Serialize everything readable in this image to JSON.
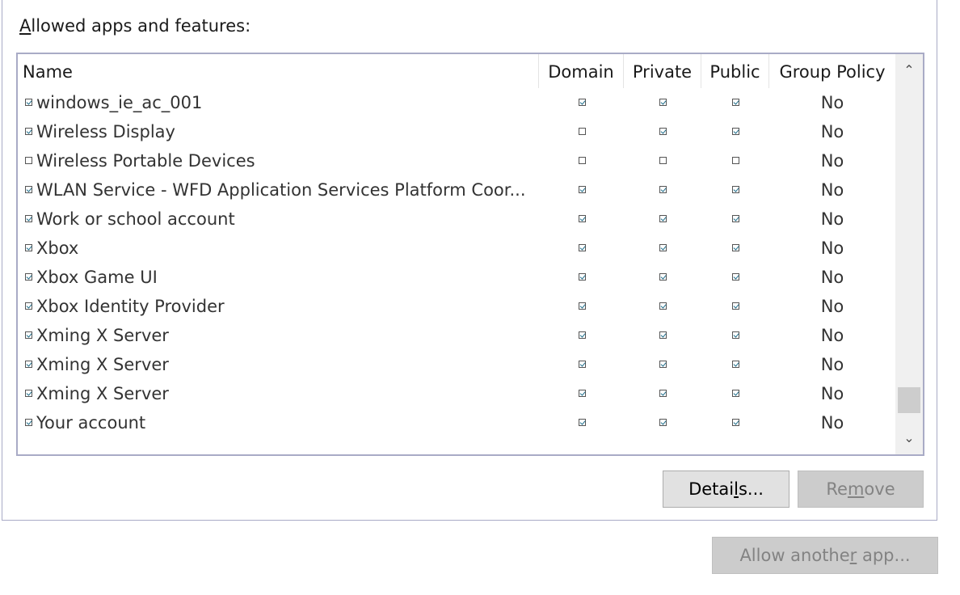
{
  "panel": {
    "title_accel": "A",
    "title_rest": "llowed apps and features:"
  },
  "columns": {
    "name": "Name",
    "domain": "Domain",
    "private": "Private",
    "public": "Public",
    "group_policy": "Group Policy"
  },
  "rows": [
    {
      "enabled": true,
      "name": "windows_ie_ac_001",
      "domain": true,
      "private": true,
      "public": true,
      "group_policy": "No"
    },
    {
      "enabled": true,
      "name": "Wireless Display",
      "domain": false,
      "private": true,
      "public": true,
      "group_policy": "No"
    },
    {
      "enabled": false,
      "name": "Wireless Portable Devices",
      "domain": false,
      "private": false,
      "public": false,
      "group_policy": "No"
    },
    {
      "enabled": true,
      "name": "WLAN Service - WFD Application Services Platform Coor...",
      "domain": true,
      "private": true,
      "public": true,
      "group_policy": "No"
    },
    {
      "enabled": true,
      "name": "Work or school account",
      "domain": true,
      "private": true,
      "public": true,
      "group_policy": "No"
    },
    {
      "enabled": true,
      "name": "Xbox",
      "domain": true,
      "private": true,
      "public": true,
      "group_policy": "No"
    },
    {
      "enabled": true,
      "name": "Xbox Game UI",
      "domain": true,
      "private": true,
      "public": true,
      "group_policy": "No"
    },
    {
      "enabled": true,
      "name": "Xbox Identity Provider",
      "domain": true,
      "private": true,
      "public": true,
      "group_policy": "No"
    },
    {
      "enabled": true,
      "name": "Xming X Server",
      "domain": true,
      "private": true,
      "public": true,
      "group_policy": "No"
    },
    {
      "enabled": true,
      "name": "Xming X Server",
      "domain": true,
      "private": true,
      "public": true,
      "group_policy": "No"
    },
    {
      "enabled": true,
      "name": "Xming X Server",
      "domain": true,
      "private": true,
      "public": true,
      "group_policy": "No"
    },
    {
      "enabled": true,
      "name": "Your account",
      "domain": true,
      "private": true,
      "public": true,
      "group_policy": "No"
    }
  ],
  "buttons": {
    "details": {
      "pre": "Detai",
      "accel": "l",
      "post": "s..."
    },
    "remove": {
      "pre": "Re",
      "accel": "m",
      "post": "ove"
    },
    "allow_another": {
      "pre": "Allow anothe",
      "accel": "r",
      "post": " app..."
    }
  },
  "scroll": {
    "position_fraction": 0.97
  },
  "icons": {
    "scroll_up": "chevron-up-icon",
    "scroll_down": "chevron-down-icon"
  }
}
